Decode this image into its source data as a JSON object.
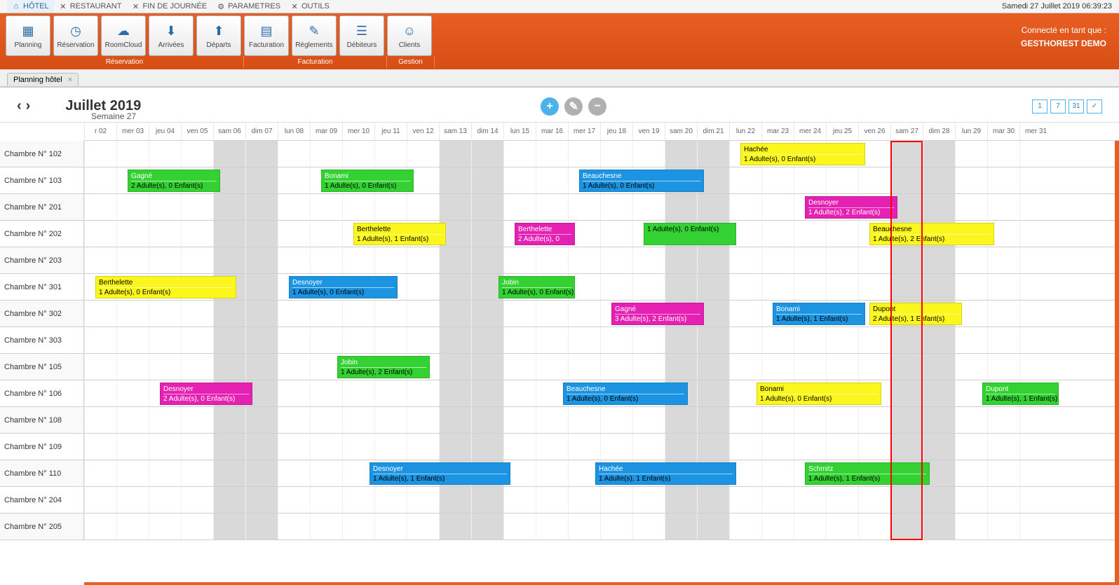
{
  "menubar": {
    "items": [
      {
        "label": "HÔTEL",
        "active": true
      },
      {
        "label": "RESTAURANT"
      },
      {
        "label": "FIN DE JOURNÉE"
      },
      {
        "label": "PARAMETRES"
      },
      {
        "label": "OUTILS"
      }
    ],
    "date_label": "Samedi 27 Juillet 2019 06:39:23"
  },
  "ribbon": {
    "buttons": [
      {
        "label": "Planning"
      },
      {
        "label": "Réservation"
      },
      {
        "label": "RoomCloud"
      },
      {
        "label": "Arrivées"
      },
      {
        "label": "Départs"
      },
      {
        "label": "Facturation"
      },
      {
        "label": "Règlements"
      },
      {
        "label": "Débiteurs"
      },
      {
        "label": "Clients"
      }
    ],
    "groups": [
      {
        "label": "Réservation",
        "span": 5
      },
      {
        "label": "Facturation",
        "span": 3
      },
      {
        "label": "Gestion",
        "span": 1
      }
    ],
    "connected_label": "Connecté en tant que :",
    "connected_user": "GESTHOREST DEMO"
  },
  "tab": {
    "label": "Planning hôtel",
    "close": "×"
  },
  "header": {
    "month": "Juillet 2019",
    "week": "Semaine 27",
    "view_buttons": [
      "1",
      "7",
      "31",
      "✓"
    ]
  },
  "days": [
    "r 02",
    "mer 03",
    "jeu 04",
    "ven 05",
    "sam 06",
    "dim 07",
    "lun 08",
    "mar 09",
    "mer 10",
    "jeu 11",
    "ven 12",
    "sam 13",
    "dim 14",
    "lun 15",
    "mar 16",
    "mer 17",
    "jeu 18",
    "ven 19",
    "sam 20",
    "dim 21",
    "lun 22",
    "mar 23",
    "mer 24",
    "jeu 25",
    "ven 26",
    "sam 27",
    "dim 28",
    "lun 29",
    "mar 30",
    "mer 31"
  ],
  "weekend_indices": [
    4,
    5,
    11,
    12,
    18,
    19,
    25,
    26
  ],
  "today_index": 25,
  "rooms": [
    "Chambre N° 102",
    "Chambre N° 103",
    "Chambre N° 201",
    "Chambre N° 202",
    "Chambre N° 203",
    "Chambre N° 301",
    "Chambre N° 302",
    "Chambre N° 303",
    "Chambre N° 105",
    "Chambre N° 106",
    "Chambre N° 108",
    "Chambre N° 109",
    "Chambre N° 110",
    "Chambre N° 204",
    "Chambre N° 205"
  ],
  "events": [
    {
      "room": 0,
      "start": 20,
      "span": 4,
      "color": "yellow",
      "name": "Hachée",
      "det": "1 Adulte(s), 0 Enfant(s)"
    },
    {
      "room": 1,
      "start": 1,
      "span": 3,
      "color": "green",
      "name": "Gagné",
      "det": "2 Adulte(s), 0 Enfant(s)"
    },
    {
      "room": 1,
      "start": 7,
      "span": 3,
      "color": "green",
      "name": "Bonami",
      "det": "1 Adulte(s), 0 Enfant(s)"
    },
    {
      "room": 1,
      "start": 15,
      "span": 4,
      "color": "blue",
      "name": "Beauchesne",
      "det": "1 Adulte(s), 0 Enfant(s)"
    },
    {
      "room": 2,
      "start": 22,
      "span": 3,
      "color": "magenta",
      "name": "Desnoyer",
      "det": "1 Adulte(s), 2 Enfant(s)"
    },
    {
      "room": 3,
      "start": 8,
      "span": 3,
      "color": "yellow",
      "name": "Berthelette",
      "det": "1 Adulte(s), 1 Enfant(s)"
    },
    {
      "room": 3,
      "start": 13,
      "span": 2,
      "color": "magenta",
      "name": "Berthelette",
      "det": "2 Adulte(s), 0"
    },
    {
      "room": 3,
      "start": 17,
      "span": 3,
      "color": "green",
      "name": "",
      "det": "1 Adulte(s), 0 Enfant(s)"
    },
    {
      "room": 3,
      "start": 24,
      "span": 4,
      "color": "yellow",
      "name": "Beauchesne",
      "det": "1 Adulte(s), 2 Enfant(s)"
    },
    {
      "room": 5,
      "start": 0,
      "span": 4.5,
      "color": "yellow",
      "name": "Berthelette",
      "det": "1 Adulte(s), 0 Enfant(s)"
    },
    {
      "room": 5,
      "start": 6,
      "span": 3.5,
      "color": "blue",
      "name": "Desnoyer",
      "det": "1 Adulte(s), 0 Enfant(s)"
    },
    {
      "room": 5,
      "start": 12.5,
      "span": 2.5,
      "color": "green",
      "name": "Jobin",
      "det": "1 Adulte(s), 0 Enfant(s)"
    },
    {
      "room": 6,
      "start": 16,
      "span": 3,
      "color": "magenta",
      "name": "Gagné",
      "det": "3 Adulte(s), 2 Enfant(s)"
    },
    {
      "room": 6,
      "start": 21,
      "span": 3,
      "color": "blue",
      "name": "Bonami",
      "det": "1 Adulte(s), 1 Enfant(s)"
    },
    {
      "room": 6,
      "start": 24,
      "span": 3,
      "color": "yellow",
      "name": "Dupont",
      "det": "2 Adulte(s), 1 Enfant(s)"
    },
    {
      "room": 8,
      "start": 7.5,
      "span": 3,
      "color": "green",
      "name": "Jobin",
      "det": "1 Adulte(s), 2 Enfant(s)"
    },
    {
      "room": 9,
      "start": 2,
      "span": 3,
      "color": "magenta",
      "name": "Desnoyer",
      "det": "2 Adulte(s), 0 Enfant(s)"
    },
    {
      "room": 9,
      "start": 14.5,
      "span": 4,
      "color": "blue",
      "name": "Beauchesne",
      "det": "1 Adulte(s), 0 Enfant(s)"
    },
    {
      "room": 9,
      "start": 20.5,
      "span": 4,
      "color": "yellow",
      "name": "Bonami",
      "det": "1 Adulte(s), 0 Enfant(s)"
    },
    {
      "room": 9,
      "start": 27.5,
      "span": 2.5,
      "color": "green",
      "name": "Dupont",
      "det": "1 Adulte(s), 1 Enfant(s)"
    },
    {
      "room": 12,
      "start": 8.5,
      "span": 4.5,
      "color": "blue",
      "name": "Desnoyer",
      "det": "1 Adulte(s), 1 Enfant(s)"
    },
    {
      "room": 12,
      "start": 15.5,
      "span": 4.5,
      "color": "blue",
      "name": "Hachée",
      "det": "1 Adulte(s), 1 Enfant(s)"
    },
    {
      "room": 12,
      "start": 22,
      "span": 4,
      "color": "green",
      "name": "Schmitz",
      "det": "1 Adulte(s), 1 Enfant(s)"
    }
  ]
}
